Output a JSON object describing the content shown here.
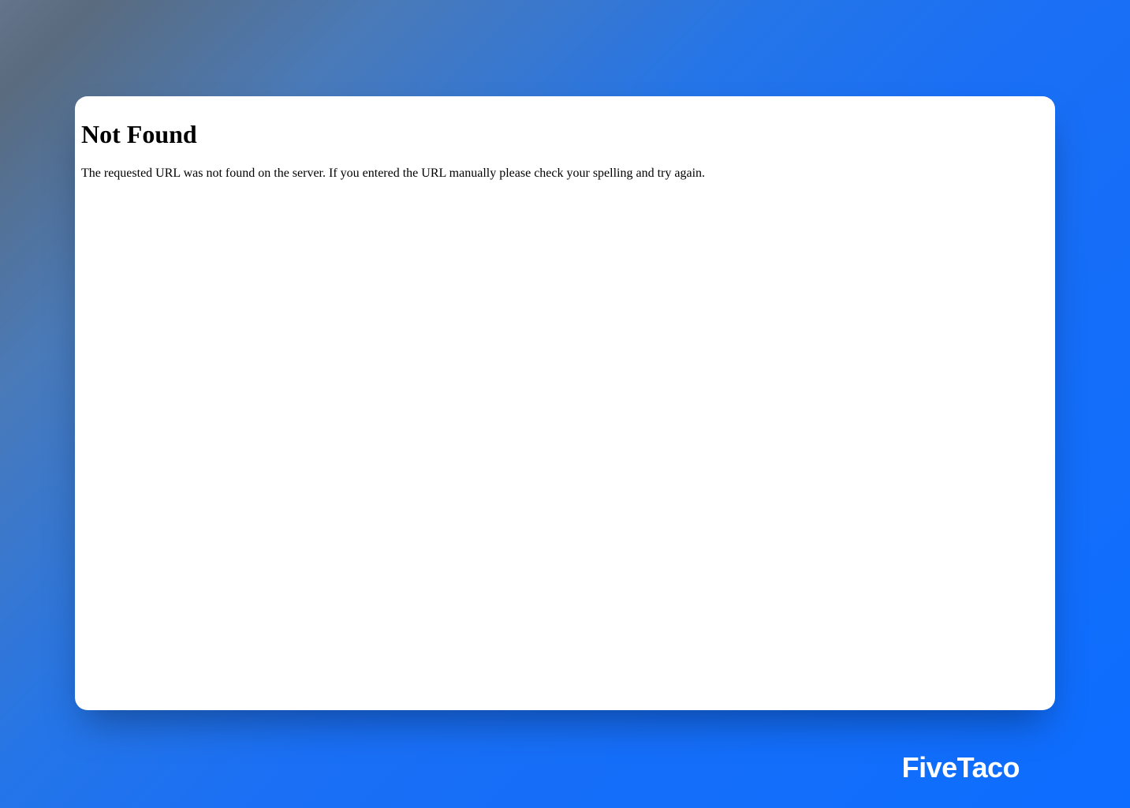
{
  "error": {
    "heading": "Not Found",
    "message": "The requested URL was not found on the server. If you entered the URL manually please check your spelling and try again."
  },
  "brand": {
    "name": "FiveTaco"
  }
}
